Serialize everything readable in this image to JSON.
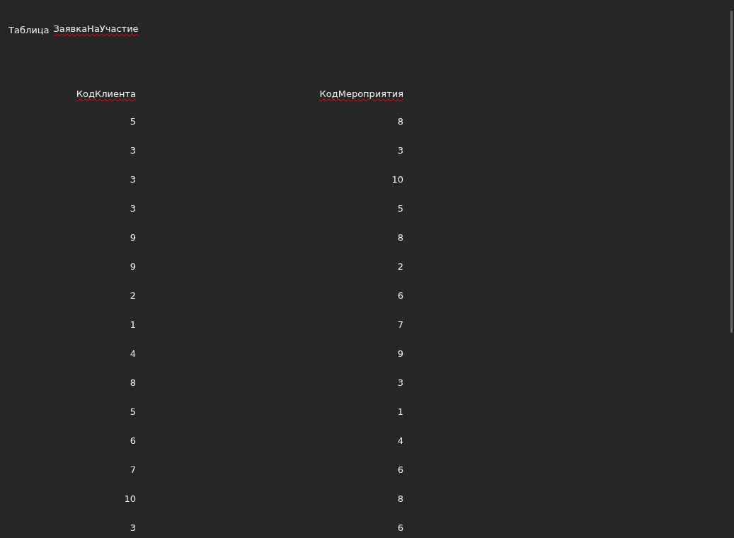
{
  "title": {
    "prefix": "Таблица",
    "name": "ЗаявкаНаУчастие",
    "misspelled": true
  },
  "table": {
    "columns": [
      {
        "label": "КодКлиента",
        "misspelled": true
      },
      {
        "label": "КодМероприятия",
        "misspelled": true
      }
    ],
    "rows": [
      [
        "5",
        "8"
      ],
      [
        "3",
        "3"
      ],
      [
        "3",
        "10"
      ],
      [
        "3",
        "5"
      ],
      [
        "9",
        "8"
      ],
      [
        "9",
        "2"
      ],
      [
        "2",
        "6"
      ],
      [
        "1",
        "7"
      ],
      [
        "4",
        "9"
      ],
      [
        "8",
        "3"
      ],
      [
        "5",
        "1"
      ],
      [
        "6",
        "4"
      ],
      [
        "7",
        "6"
      ],
      [
        "10",
        "8"
      ],
      [
        "3",
        "6"
      ]
    ]
  }
}
